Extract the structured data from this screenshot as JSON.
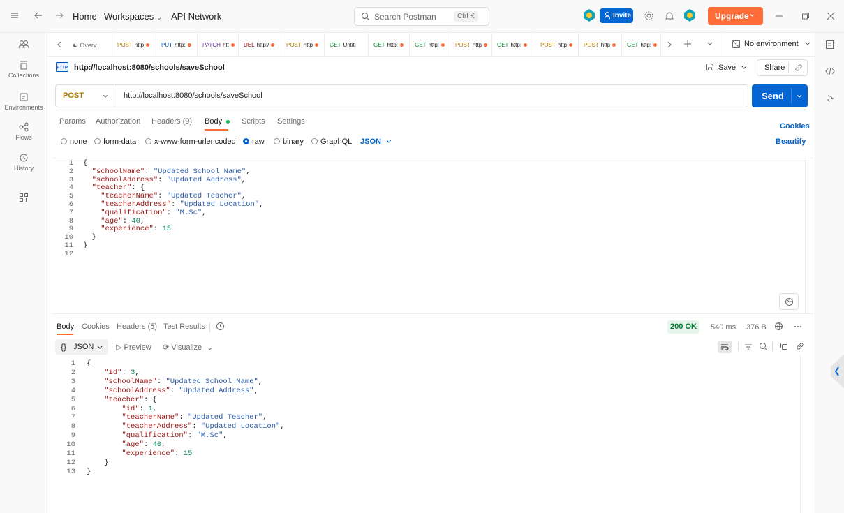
{
  "topbar": {
    "nav": {
      "home": "Home",
      "workspaces": "Workspaces",
      "api_network": "API Network"
    },
    "search": {
      "placeholder": "Search Postman",
      "shortcut": "Ctrl K"
    },
    "invite_label": "Invite",
    "upgrade_label": "Upgrade"
  },
  "sidebar": {
    "items": [
      {
        "label": "",
        "icon": "team-icon"
      },
      {
        "label": "Collections",
        "icon": "collections-icon"
      },
      {
        "label": "Environments",
        "icon": "environments-icon"
      },
      {
        "label": "Flows",
        "icon": "flows-icon"
      },
      {
        "label": "History",
        "icon": "history-icon"
      },
      {
        "label": "",
        "icon": "add-apps-icon"
      }
    ]
  },
  "tabs": {
    "items": [
      {
        "method": "",
        "label": "Overv",
        "method_color": "#6b6b6b",
        "dot": false
      },
      {
        "method": "POST",
        "label": "http",
        "method_color": "#ad7a03",
        "dot": true
      },
      {
        "method": "PUT",
        "label": "http:",
        "method_color": "#0053b8",
        "dot": true
      },
      {
        "method": "PATCH",
        "label": "htt",
        "method_color": "#623497",
        "dot": true
      },
      {
        "method": "DEL",
        "label": "http:/",
        "method_color": "#8e1a10",
        "dot": true
      },
      {
        "method": "POST",
        "label": "http",
        "method_color": "#ad7a03",
        "dot": true
      },
      {
        "method": "GET",
        "label": "Untitl",
        "method_color": "#007f31",
        "dot": false
      },
      {
        "method": "GET",
        "label": "http:",
        "method_color": "#007f31",
        "dot": true
      },
      {
        "method": "GET",
        "label": "http:",
        "method_color": "#007f31",
        "dot": true
      },
      {
        "method": "POST",
        "label": "http",
        "method_color": "#ad7a03",
        "dot": true
      },
      {
        "method": "GET",
        "label": "http:",
        "method_color": "#007f31",
        "dot": true
      },
      {
        "method": "POST",
        "label": "http",
        "method_color": "#ad7a03",
        "dot": true
      },
      {
        "method": "POST",
        "label": "http",
        "method_color": "#ad7a03",
        "dot": true
      },
      {
        "method": "GET",
        "label": "http:",
        "method_color": "#007f31",
        "dot": true
      }
    ],
    "environment": "No environment"
  },
  "request": {
    "title": "http://localhost:8080/schools/saveSchool",
    "save_label": "Save",
    "share_label": "Share",
    "method": "POST",
    "url": "http://localhost:8080/schools/saveSchool",
    "send_label": "Send",
    "tabs": {
      "params": "Params",
      "authorization": "Authorization",
      "headers": "Headers (9)",
      "body": "Body",
      "scripts": "Scripts",
      "settings": "Settings"
    },
    "cookies_label": "Cookies",
    "beautify_label": "Beautify",
    "body_types": {
      "none": "none",
      "form_data": "form-data",
      "urlencoded": "x-www-form-urlencoded",
      "raw": "raw",
      "binary": "binary",
      "graphql": "GraphQL"
    },
    "format": "JSON",
    "body_lines": [
      "{",
      "  \"schoolName\": \"Updated School Name\",",
      "  \"schoolAddress\": \"Updated Address\",",
      "  \"teacher\": {",
      "    \"teacherName\": \"Updated Teacher\",",
      "    \"teacherAddress\": \"Updated Location\",",
      "    \"qualification\": \"M.Sc\",",
      "    \"age\": 40,",
      "    \"experience\": 15",
      "  }",
      "}",
      ""
    ]
  },
  "response": {
    "tabs": {
      "body": "Body",
      "cookies": "Cookies",
      "headers": "Headers (5)",
      "tests": "Test Results"
    },
    "status": "200 OK",
    "time": "540 ms",
    "size": "376 B",
    "format": "JSON",
    "preview_label": "Preview",
    "visualize_label": "Visualize",
    "body_lines": [
      "{",
      "    \"id\": 3,",
      "    \"schoolName\": \"Updated School Name\",",
      "    \"schoolAddress\": \"Updated Address\",",
      "    \"teacher\": {",
      "        \"id\": 1,",
      "        \"teacherName\": \"Updated Teacher\",",
      "        \"teacherAddress\": \"Updated Location\",",
      "        \"qualification\": \"M.Sc\",",
      "        \"age\": 40,",
      "        \"experience\": 15",
      "    }",
      "}"
    ]
  }
}
